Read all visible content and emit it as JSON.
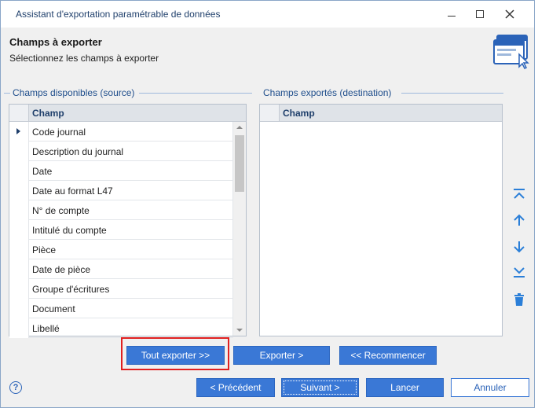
{
  "window": {
    "title": "Assistant d'exportation paramétrable de données",
    "minimize_icon": "minimize-icon",
    "maximize_icon": "maximize-icon",
    "close_icon": "close-icon"
  },
  "header": {
    "title": "Champs à exporter",
    "subtitle": "Sélectionnez les champs à exporter",
    "icon": "window-cursor-icon"
  },
  "source": {
    "group_label": "Champs disponibles (source)",
    "column_header": "Champ",
    "rows": [
      "Code journal",
      "Description du journal",
      "Date",
      "Date au format L47",
      "N° de compte",
      "Intitulé du compte",
      "Pièce",
      "Date de pièce",
      "Groupe d'écritures",
      "Document",
      "Libellé"
    ],
    "current_row_index": 0
  },
  "destination": {
    "group_label": "Champs exportés (destination)",
    "column_header": "Champ"
  },
  "tools": {
    "move_top_icon": "move-to-top-icon",
    "move_up_icon": "arrow-up-icon",
    "move_down_icon": "arrow-down-icon",
    "move_bottom_icon": "move-to-bottom-icon",
    "delete_icon": "trash-icon"
  },
  "actions": {
    "export_all": "Tout exporter >>",
    "export": "Exporter >",
    "restart": "<< Recommencer"
  },
  "footer": {
    "help": "?",
    "previous": "< Précédent",
    "next": "Suivant >",
    "launch": "Lancer",
    "cancel": "Annuler"
  },
  "colors": {
    "accent": "#3a78d6",
    "highlight": "#e02020",
    "group_label": "#1f4e8c"
  }
}
